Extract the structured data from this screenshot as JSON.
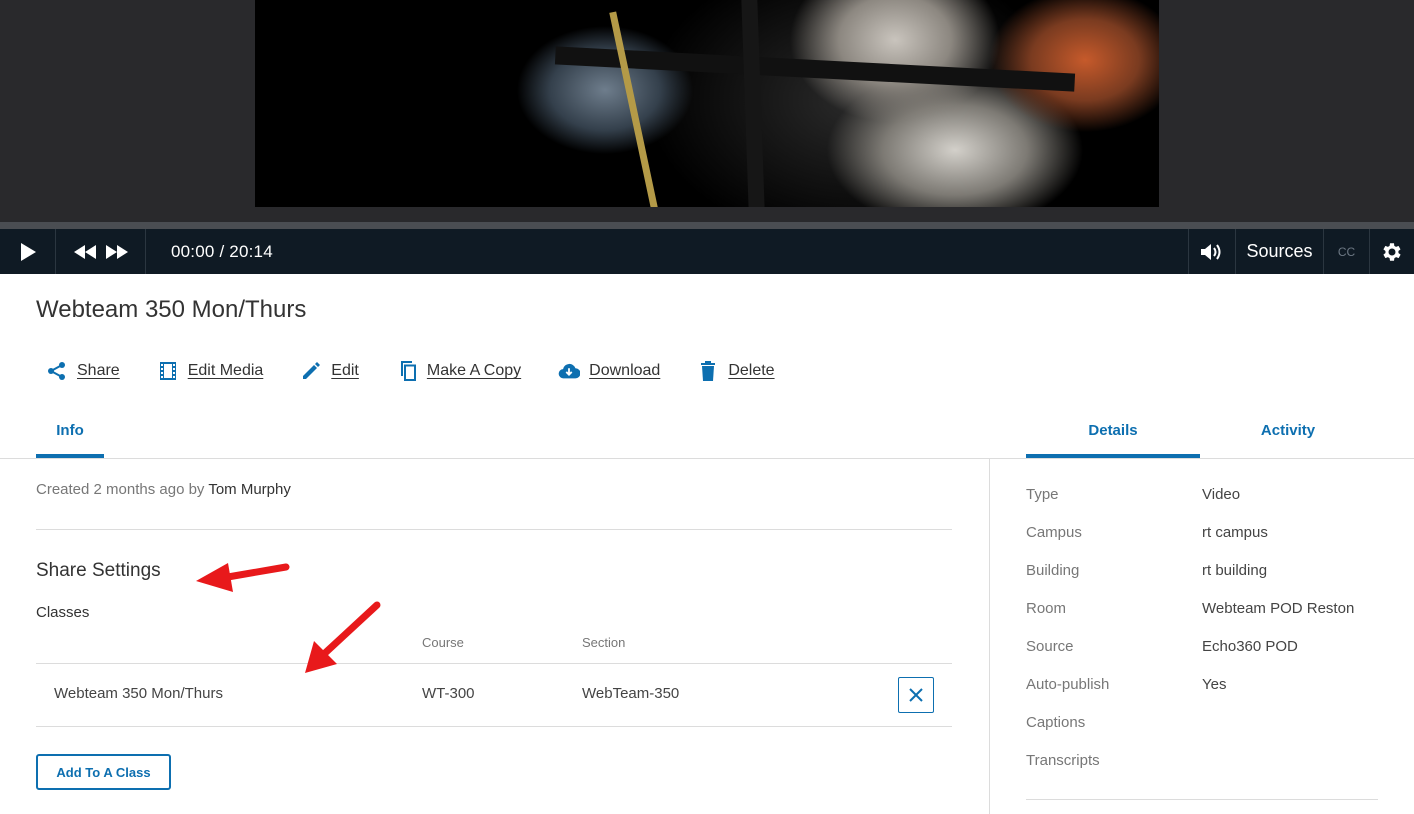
{
  "player": {
    "time_display": "00:00 / 20:14",
    "sources_label": "Sources",
    "cc_label": "CC"
  },
  "page": {
    "title": "Webteam 350 Mon/Thurs"
  },
  "actions": [
    {
      "label": "Share",
      "icon": "share-icon"
    },
    {
      "label": "Edit Media",
      "icon": "film-icon"
    },
    {
      "label": "Edit",
      "icon": "pencil-icon"
    },
    {
      "label": "Make A Copy",
      "icon": "copy-icon"
    },
    {
      "label": "Download",
      "icon": "cloud-download-icon"
    },
    {
      "label": "Delete",
      "icon": "trash-icon"
    }
  ],
  "tabs": {
    "info": "Info",
    "details": "Details",
    "activity": "Activity"
  },
  "info": {
    "created_prefix": "Created 2 months ago by",
    "created_by": "Tom Murphy",
    "share_settings_heading": "Share Settings",
    "classes_heading": "Classes",
    "columns": {
      "course": "Course",
      "section": "Section"
    },
    "class_rows": [
      {
        "name": "Webteam 350 Mon/Thurs",
        "course": "WT-300",
        "section": "WebTeam-350"
      }
    ],
    "add_button": "Add To A Class"
  },
  "details": [
    {
      "key": "Type",
      "value": "Video"
    },
    {
      "key": "Campus",
      "value": "rt campus"
    },
    {
      "key": "Building",
      "value": "rt building"
    },
    {
      "key": "Room",
      "value": "Webteam POD Reston"
    },
    {
      "key": "Source",
      "value": "Echo360 POD"
    },
    {
      "key": "Auto-publish",
      "value": "Yes"
    },
    {
      "key": "Captions",
      "value": ""
    },
    {
      "key": "Transcripts",
      "value": ""
    }
  ],
  "colors": {
    "accent": "#0d6fb0",
    "player_bar": "#0f1a24",
    "annotation": "#e8191b"
  }
}
